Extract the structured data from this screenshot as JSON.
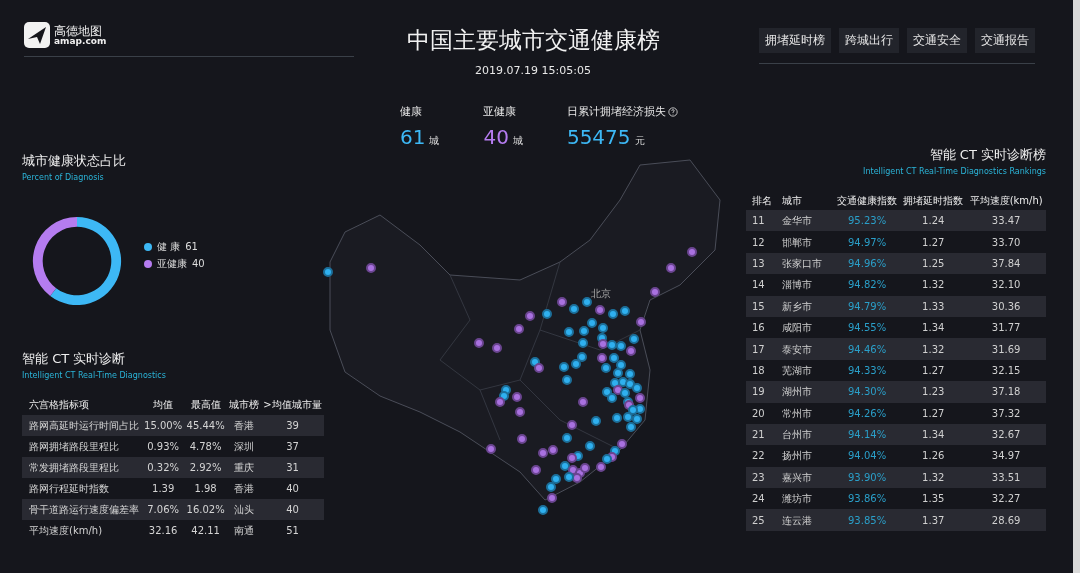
{
  "header": {
    "logo_text": "高德地图",
    "logo_domain": "amap.com",
    "title": "中国主要城市交通健康榜",
    "datetime": "2019.07.19 15:05:05",
    "nav": [
      {
        "label": "拥堵延时榜"
      },
      {
        "label": "跨城出行"
      },
      {
        "label": "交通安全"
      },
      {
        "label": "交通报告"
      }
    ]
  },
  "stats": [
    {
      "label": "健康",
      "value": "61",
      "unit": "城",
      "kind": "healthy"
    },
    {
      "label": "亚健康",
      "value": "40",
      "unit": "城",
      "kind": "subhealthy"
    },
    {
      "label": "日累计拥堵经济损失",
      "value": "55475",
      "unit": "元",
      "kind": "loss",
      "help_icon": true
    }
  ],
  "health_share": {
    "title": "城市健康状态占比",
    "subtitle": "Percent of Diagnosis",
    "legend": [
      {
        "value": "61",
        "color": "#3db8f5"
      },
      {
        "value": "40",
        "color": "#b57cf0"
      }
    ],
    "chart_data": {
      "type": "donut",
      "categories": [
        "健 康",
        "亚健康"
      ],
      "values": [
        61,
        40
      ]
    }
  },
  "diagnostics": {
    "title": "智能 CT 实时诊断",
    "subtitle": "Intelligent CT Real-Time Diagnostics",
    "columns": [
      "六宫格指标项",
      "均值",
      "最高值",
      "城市榜",
      ">均值城市量"
    ],
    "rows": [
      [
        "路网高延时运行时间占比",
        "15.00%",
        "45.44%",
        "香港",
        "39"
      ],
      [
        "路网拥堵路段里程比",
        "0.93%",
        "4.78%",
        "深圳",
        "37"
      ],
      [
        "常发拥堵路段里程比",
        "0.32%",
        "2.92%",
        "重庆",
        "31"
      ],
      [
        "路网行程延时指数",
        "1.39",
        "1.98",
        "香港",
        "40"
      ],
      [
        "骨干道路运行速度偏差率",
        "7.06%",
        "16.02%",
        "汕头",
        "40"
      ],
      [
        "平均速度(km/h)",
        "32.16",
        "42.11",
        "南通",
        "51"
      ]
    ]
  },
  "map": {
    "city_label": "北京"
  },
  "rankings": {
    "title": "智能 CT 实时诊断榜",
    "subtitle": "Intelligent CT Real-Time Diagnostics Rankings",
    "columns": [
      "排名",
      "城市",
      "交通健康指数",
      "拥堵延时指数",
      "平均速度(km/h)"
    ],
    "rows": [
      [
        "11",
        "金华市",
        "95.23%",
        "1.24",
        "33.47"
      ],
      [
        "12",
        "邯郸市",
        "94.97%",
        "1.27",
        "33.70"
      ],
      [
        "13",
        "张家口市",
        "94.96%",
        "1.25",
        "37.84"
      ],
      [
        "14",
        "淄博市",
        "94.82%",
        "1.32",
        "32.10"
      ],
      [
        "15",
        "新乡市",
        "94.79%",
        "1.33",
        "30.36"
      ],
      [
        "16",
        "咸阳市",
        "94.55%",
        "1.34",
        "31.77"
      ],
      [
        "17",
        "泰安市",
        "94.46%",
        "1.32",
        "31.69"
      ],
      [
        "18",
        "芜湖市",
        "94.33%",
        "1.27",
        "32.15"
      ],
      [
        "19",
        "湖州市",
        "94.30%",
        "1.23",
        "37.18"
      ],
      [
        "20",
        "常州市",
        "94.26%",
        "1.27",
        "37.32"
      ],
      [
        "21",
        "台州市",
        "94.14%",
        "1.34",
        "32.67"
      ],
      [
        "22",
        "扬州市",
        "94.04%",
        "1.26",
        "34.97"
      ],
      [
        "23",
        "嘉兴市",
        "93.90%",
        "1.32",
        "33.51"
      ],
      [
        "24",
        "潍坊市",
        "93.86%",
        "1.35",
        "32.27"
      ],
      [
        "25",
        "连云港",
        "93.85%",
        "1.37",
        "28.69"
      ]
    ]
  }
}
